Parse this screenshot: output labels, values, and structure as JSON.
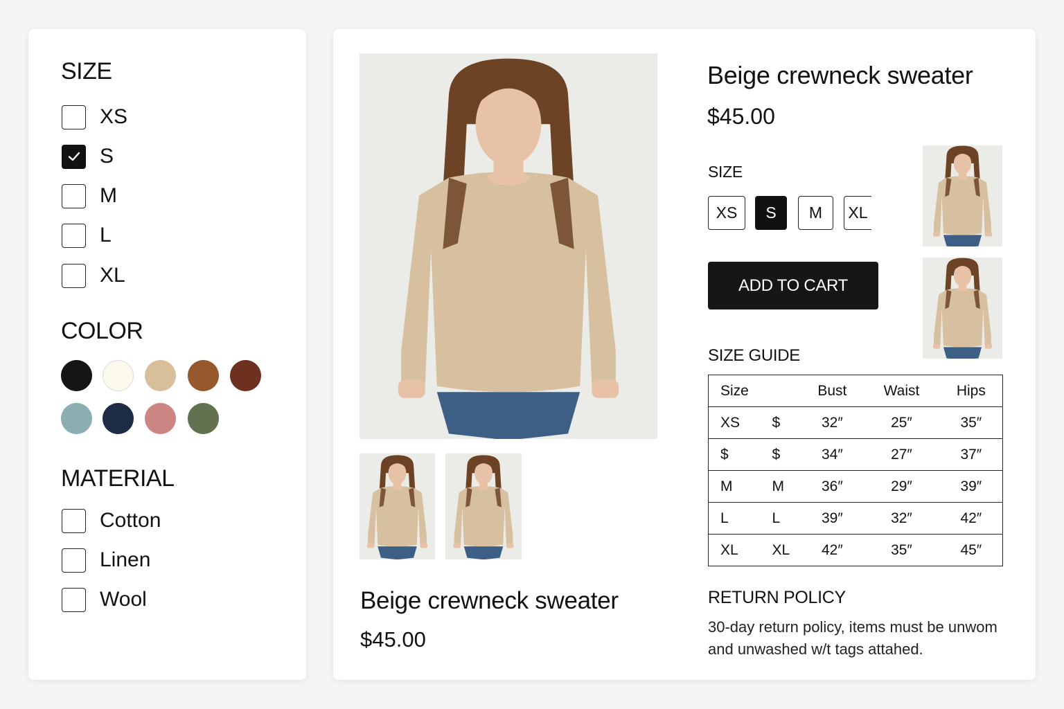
{
  "filters": {
    "size": {
      "heading": "SIZE",
      "options": [
        {
          "label": "XS",
          "checked": false
        },
        {
          "label": "S",
          "checked": true
        },
        {
          "label": "M",
          "checked": false
        },
        {
          "label": "L",
          "checked": false
        },
        {
          "label": "XL",
          "checked": false
        }
      ]
    },
    "color": {
      "heading": "COLOR",
      "swatches": [
        "#151515",
        "#fbf8ec",
        "#d8bf9c",
        "#96592d",
        "#6e301f",
        "#8aaeb2",
        "#1e2b45",
        "#cd8583",
        "#647150"
      ]
    },
    "material": {
      "heading": "MATERIAL",
      "options": [
        {
          "label": "Cotton",
          "checked": false
        },
        {
          "label": "Linen",
          "checked": false
        },
        {
          "label": "Wool",
          "checked": false
        }
      ]
    }
  },
  "product": {
    "title": "Beige crewneck sweater",
    "price": "$45.00",
    "size_heading": "SIZE",
    "sizes": [
      "XS",
      "S",
      "M",
      "XL"
    ],
    "selected_size": "S",
    "add_to_cart_label": "ADD TO CART",
    "size_guide": {
      "heading": "SIZE GUIDE",
      "columns": [
        "Size",
        "",
        "Bust",
        "Waist",
        "Hips"
      ],
      "rows": [
        [
          "XS",
          "$",
          "32″",
          "25″",
          "35″"
        ],
        [
          "$",
          "$",
          "34″",
          "27″",
          "37″"
        ],
        [
          "M",
          "M",
          "36″",
          "29″",
          "39″"
        ],
        [
          "L",
          "L",
          "39″",
          "32″",
          "42″"
        ],
        [
          "XL",
          "XL",
          "42″",
          "35″",
          "45″"
        ]
      ]
    },
    "return_policy": {
      "heading": "RETURN POLICY",
      "text": "30-day return policy, items must be unwom and unwashed w/t tags attahed."
    }
  },
  "colors": {
    "sweater": "#d6c0a0",
    "jeans": "#3d5f86",
    "hair": "#6d4326",
    "skin": "#e8c2a6",
    "photo_bg": "#ebebe7"
  }
}
